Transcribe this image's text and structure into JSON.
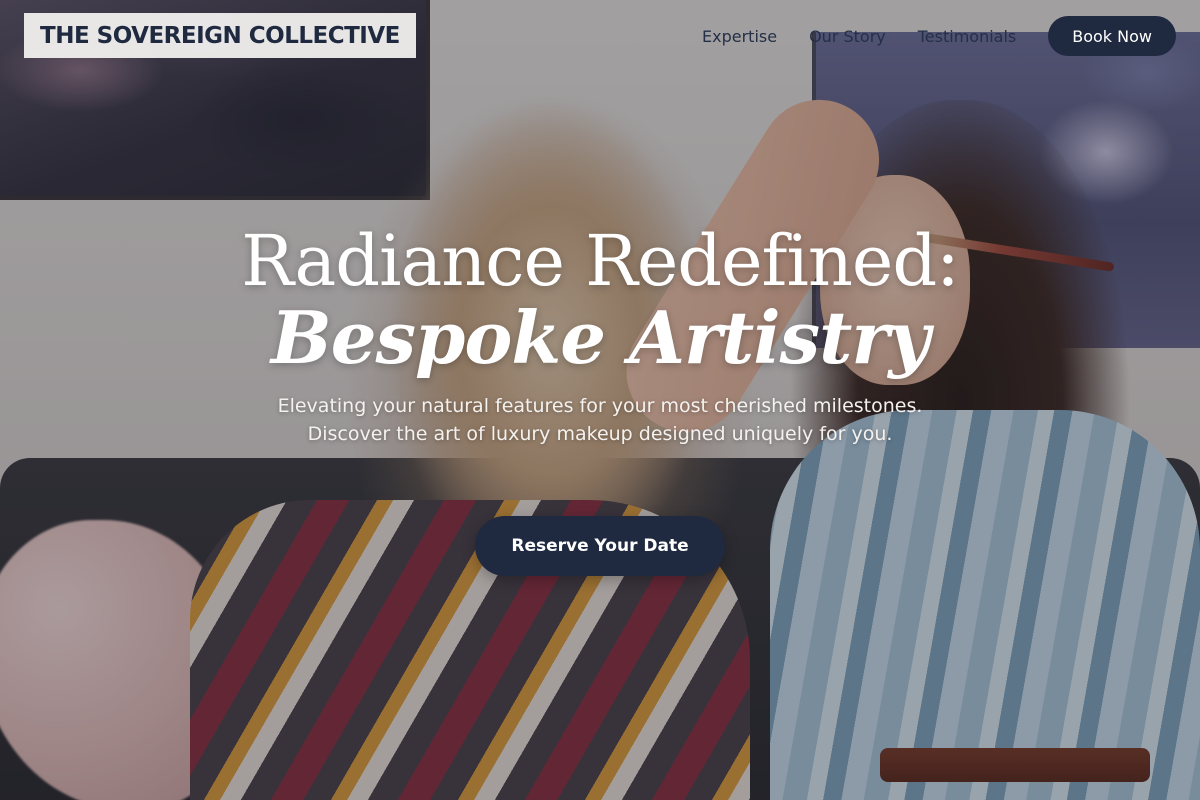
{
  "brand": {
    "name": "THE SOVEREIGN COLLECTIVE"
  },
  "nav": {
    "links": [
      "Expertise",
      "Our Story",
      "Testimonials"
    ],
    "cta_label": "Book Now"
  },
  "hero": {
    "headline_line1": "Radiance Redefined:",
    "headline_line2": "Bespoke Artistry",
    "subtitle": "Elevating your natural features for your most cherished milestones. Discover the art of luxury makeup designed uniquely for you.",
    "cta_label": "Reserve Your Date"
  },
  "colors": {
    "primary": "#1f2a40",
    "text_light": "#ffffff",
    "logo_bg": "#f5f4f2"
  }
}
